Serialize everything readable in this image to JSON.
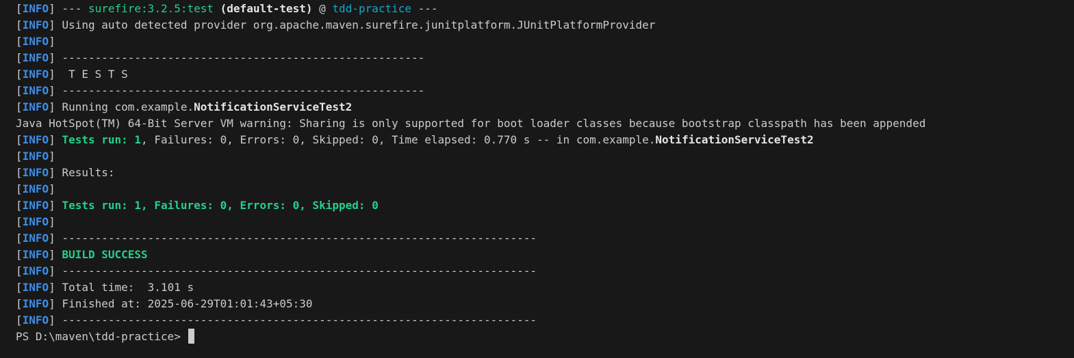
{
  "terminal": {
    "info_tag": "INFO",
    "lines": {
      "l1": {
        "pre": " --- ",
        "plugin": "surefire:3.2.5:test",
        "space1": " ",
        "exec": "(default-test)",
        "at": " @ ",
        "project": "tdd-practice",
        "post": " ---"
      },
      "l2": {
        "text": " Using auto detected provider org.apache.maven.surefire.junitplatform.JUnitPlatformProvider"
      },
      "l3": {
        "text": ""
      },
      "l4": {
        "text": " -------------------------------------------------------"
      },
      "l5": {
        "text": "  T E S T S"
      },
      "l6": {
        "text": " -------------------------------------------------------"
      },
      "l7": {
        "pre": " Running com.example.",
        "cls": "NotificationServiceTest2"
      },
      "l8": {
        "text": "Java HotSpot(TM) 64-Bit Server VM warning: Sharing is only supported for boot loader classes because bootstrap classpath has been appended"
      },
      "l9": {
        "sp": " ",
        "run": "Tests run: 1",
        "rest": ", Failures: 0, Errors: 0, Skipped: 0, Time elapsed: 0.770 s -- in com.example.",
        "cls": "NotificationServiceTest2"
      },
      "l10": {
        "text": ""
      },
      "l11": {
        "text": " Results:"
      },
      "l12": {
        "text": ""
      },
      "l13": {
        "sp": " ",
        "summary": "Tests run: 1, Failures: 0, Errors: 0, Skipped: 0"
      },
      "l14": {
        "text": ""
      },
      "l15": {
        "text": " ------------------------------------------------------------------------"
      },
      "l16": {
        "sp": " ",
        "status": "BUILD SUCCESS"
      },
      "l17": {
        "text": " ------------------------------------------------------------------------"
      },
      "l18": {
        "text": " Total time:  3.101 s"
      },
      "l19": {
        "text": " Finished at: 2025-06-29T01:01:43+05:30"
      },
      "l20": {
        "text": " ------------------------------------------------------------------------"
      }
    },
    "prompt": "PS D:\\maven\\tdd-practice> "
  },
  "colors": {
    "background": "#181818",
    "text": "#cccccc",
    "info": "#3b8eea",
    "success": "#23d18b",
    "plugin": "#11a8cd"
  }
}
